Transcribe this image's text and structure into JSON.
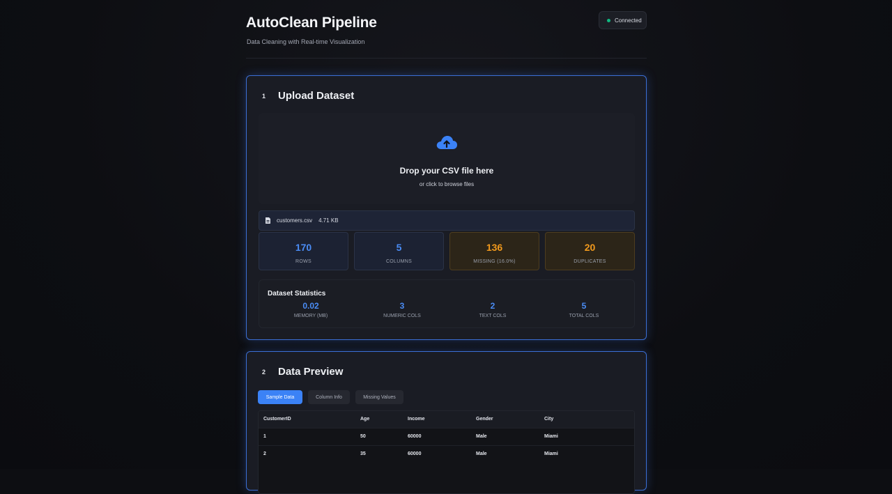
{
  "header": {
    "title": "AutoClean Pipeline",
    "subtitle": "Data Cleaning with Real-time Visualization",
    "status": "Connected"
  },
  "upload": {
    "step": "1",
    "title": "Upload Dataset",
    "drop_title": "Drop your CSV file here",
    "drop_sub": "or click to browse files",
    "file_name": "customers.csv",
    "file_size": "4.71 KB",
    "stats": [
      {
        "value": "170",
        "label": "ROWS"
      },
      {
        "value": "5",
        "label": "COLUMNS"
      },
      {
        "value": "136",
        "label": "MISSING (16.0%)"
      },
      {
        "value": "20",
        "label": "DUPLICATES"
      }
    ],
    "dataset_stats": {
      "title": "Dataset Statistics",
      "items": [
        {
          "value": "0.02",
          "label": "MEMORY (MB)"
        },
        {
          "value": "3",
          "label": "NUMERIC COLS"
        },
        {
          "value": "2",
          "label": "TEXT COLS"
        },
        {
          "value": "5",
          "label": "TOTAL COLS"
        }
      ]
    }
  },
  "preview": {
    "step": "2",
    "title": "Data Preview",
    "tabs": [
      "Sample Data",
      "Column Info",
      "Missing Values"
    ],
    "columns": [
      "CustomerID",
      "Age",
      "Income",
      "Gender",
      "City"
    ],
    "rows": [
      [
        "1",
        "50",
        "60000",
        "Male",
        "Miami"
      ],
      [
        "2",
        "35",
        "60000",
        "Male",
        "Miami"
      ]
    ]
  },
  "colors": {
    "accent": "#3b82f6",
    "stat_blue": "#4a8cf5",
    "stat_orange": "#f29a1c",
    "connected": "#10b981"
  }
}
